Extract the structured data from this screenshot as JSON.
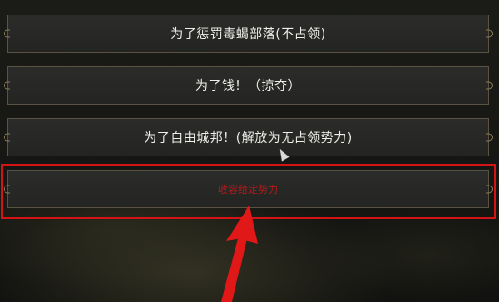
{
  "dialog": {
    "options": [
      {
        "label": "为了惩罚毒蝎部落(不占领)"
      },
      {
        "label": "为了钱！（掠夺）"
      },
      {
        "label": "为了自由城邦！(解放为无占领势力)"
      },
      {
        "label": "收容给定势力"
      }
    ]
  },
  "annotation": {
    "highlight_color": "#d41414",
    "arrow_color": "#e01818"
  }
}
